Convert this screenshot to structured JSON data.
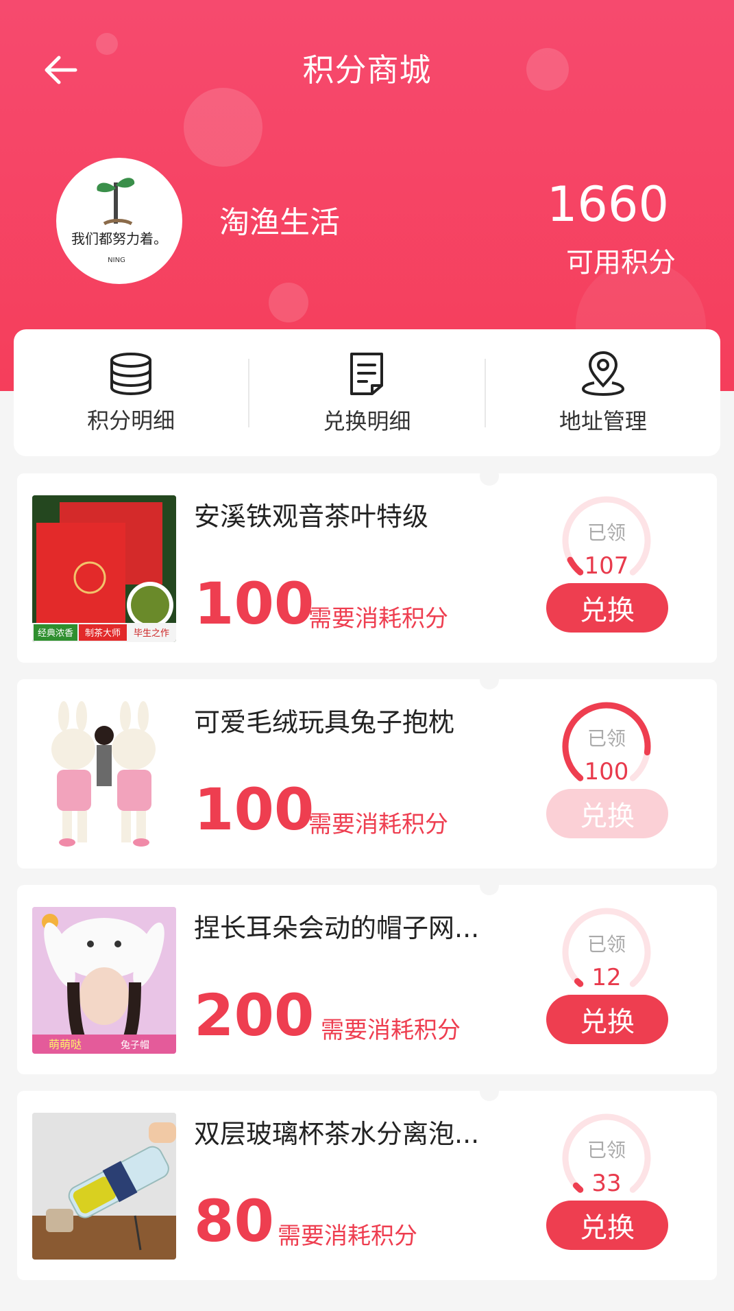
{
  "header": {
    "title": "积分商城",
    "username": "淘渔生活",
    "avatar_text": "我们都努力着。",
    "avatar_sub": "NING",
    "points": "1660",
    "points_label": "可用积分"
  },
  "menu": [
    {
      "label": "积分明细",
      "icon": "coins-stack-icon"
    },
    {
      "label": "兑换明细",
      "icon": "document-list-icon"
    },
    {
      "label": "地址管理",
      "icon": "location-pin-icon"
    }
  ],
  "common": {
    "price_label": "需要消耗积分",
    "claimed_label": "已领",
    "redeem_label": "兑换"
  },
  "products": [
    {
      "name": "安溪铁观音茶叶特级",
      "price": "100",
      "claimed": "107",
      "progress": 0.08,
      "disabled": false,
      "img_tag1": "经典浓香",
      "img_tag2": "制茶大师",
      "img_tag3": "毕生之作"
    },
    {
      "name": "可爱毛绒玩具兔子抱枕",
      "price": "100",
      "claimed": "100",
      "progress": 0.85,
      "disabled": true
    },
    {
      "name": "捏长耳朵会动的帽子网...",
      "price": "200",
      "claimed": "12",
      "progress": 0.02,
      "disabled": false,
      "img_tag1": "萌萌哒",
      "img_tag2": "兔子帽"
    },
    {
      "name": "双层玻璃杯茶水分离泡...",
      "price": "80",
      "claimed": "33",
      "progress": 0.03,
      "disabled": false
    }
  ],
  "colors": {
    "primary": "#ee3e50",
    "header": "#f64a6e",
    "disabled": "#fbd0d6"
  }
}
